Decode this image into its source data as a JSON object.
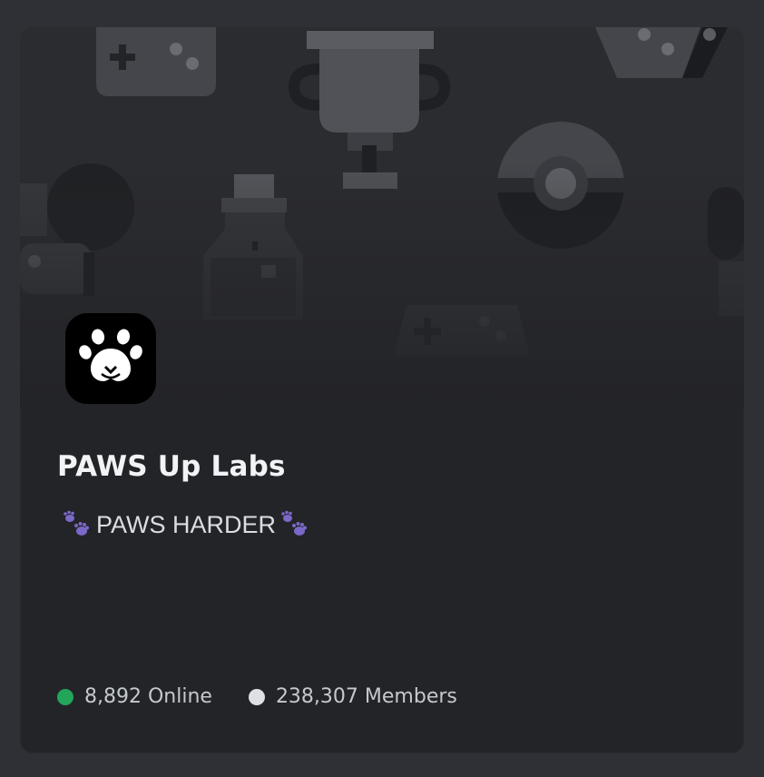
{
  "server": {
    "name": "PAWS Up Labs",
    "tagline": "PAWS HARDER",
    "icon": "paw-print-icon"
  },
  "stats": {
    "online": "8,892 Online",
    "members": "238,307 Members"
  },
  "colors": {
    "card_bg": "#232428",
    "page_bg": "#2f3035",
    "online_dot": "#23a55a",
    "members_dot": "#dee0e4",
    "emoji_paw": "#7b68c8"
  },
  "banner": {
    "icons": [
      "gamepad-icon",
      "trophy-icon",
      "dice-icon",
      "potion-bottle-icon",
      "pokeball-icon",
      "joystick-icon",
      "gamepad-icon"
    ]
  }
}
